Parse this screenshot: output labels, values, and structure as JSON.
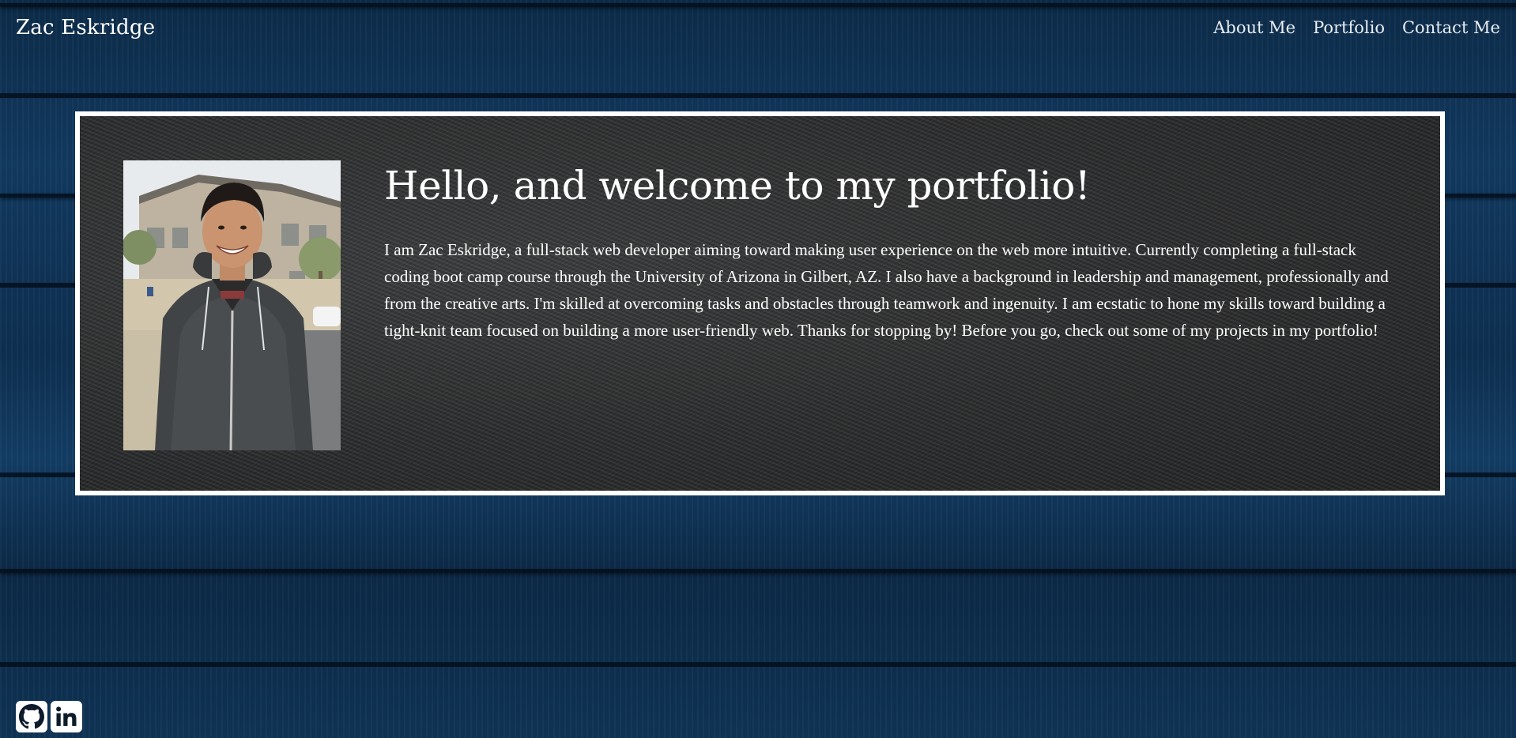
{
  "brand": "Zac Eskridge",
  "nav": {
    "items": [
      {
        "label": "About Me"
      },
      {
        "label": "Portfolio"
      },
      {
        "label": "Contact Me"
      }
    ]
  },
  "hero": {
    "title": "Hello, and welcome to my portfolio!",
    "bio": "I am Zac Eskridge, a full-stack web developer aiming toward making user experience on the web more intuitive. Currently completing a full-stack coding boot camp course through the University of Arizona in Gilbert, AZ. I also have a background in leadership and management, professionally and from the creative arts. I'm skilled at overcoming tasks and obstacles through teamwork and ingenuity. I am ecstatic to hone my skills toward building a tight-knit team focused on building a more user-friendly web. Thanks for stopping by! Before you go, check out some of my projects in my portfolio!"
  },
  "social": [
    {
      "icon": "github-icon"
    },
    {
      "icon": "linkedin-icon"
    }
  ],
  "colors": {
    "background": "#0f3355",
    "card_border": "#ffffff",
    "card_background": "#2f3031",
    "text": "#ffffff"
  }
}
